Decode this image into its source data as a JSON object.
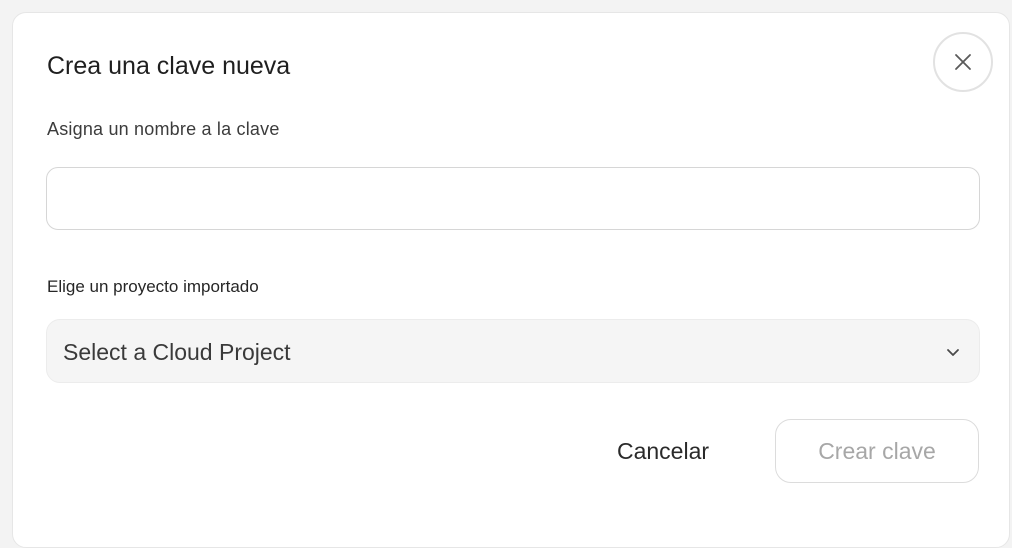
{
  "dialog": {
    "title": "Crea una clave nueva",
    "close_icon": "close-icon",
    "name_field": {
      "label": "Asigna un nombre a la clave",
      "value": "",
      "placeholder": ""
    },
    "project_field": {
      "label": "Elige un proyecto importado",
      "selected": "Select a Cloud Project",
      "icon": "chevron-down-icon"
    },
    "actions": {
      "cancel_label": "Cancelar",
      "create_label": "Crear clave",
      "create_disabled": true
    }
  }
}
